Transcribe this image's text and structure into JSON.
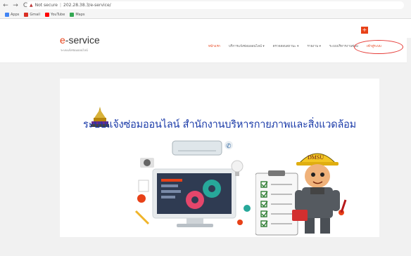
{
  "browser": {
    "back_icon": "arrow-left-icon",
    "forward_icon": "arrow-right-icon",
    "reload_icon": "reload-icon",
    "security_label": "Not secure",
    "url": "202.28.38.3/e-service/",
    "bookmarks": [
      {
        "label": "Apps",
        "color": "#4285f4"
      },
      {
        "label": "Gmail",
        "color": "#d93025"
      },
      {
        "label": "YouTube",
        "color": "#ff0000"
      },
      {
        "label": "Maps",
        "color": "#34a853"
      }
    ]
  },
  "site": {
    "brand_prefix": "e",
    "brand_rest": "-service",
    "tagline": "ระบบแจ้งซ่อมออนไลน์",
    "nav": [
      "หน้าแรก",
      "บริการแจ้งซ่อมออนไลน์ ▾",
      "ตรวจสอบสถานะ ▾",
      "รายงาน ▾",
      "ระบบบริหารงานซ่อม",
      "เข้าสู่ระบบ"
    ],
    "accent_color": "#e84118",
    "page_heading": "ระบบแจ้งซ่อมออนไลน์ สำนักงานบริหารกายภาพและสิ่งแวดล้อม",
    "helmet_text": "DMSU"
  }
}
